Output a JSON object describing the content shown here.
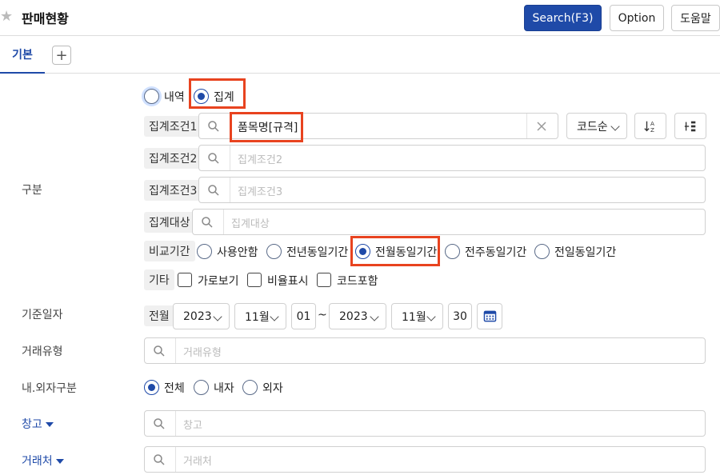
{
  "header": {
    "title": "판매현황",
    "search_label": "Search(F3)",
    "option_label": "Option",
    "help_label": "도움말"
  },
  "tabs": {
    "basic": "기본",
    "add": "+"
  },
  "labels": {
    "gubun": "구분",
    "base_date": "기준일자",
    "trade_type": "거래유형",
    "in_out": "내.외자구분",
    "warehouse": "창고",
    "customer": "거래처"
  },
  "view_mode": {
    "detail": "내역",
    "summary": "집계",
    "selected": "summary"
  },
  "agg": {
    "cond1_tag": "집계조건1",
    "cond1_value": "품목명[규격]",
    "cond2_tag": "집계조건2",
    "cond2_placeholder": "집계조건2",
    "cond3_tag": "집계조건3",
    "cond3_placeholder": "집계조건3",
    "target_tag": "집계대상",
    "target_placeholder": "집계대상",
    "sort_label": "코드순"
  },
  "compare": {
    "tag": "비교기간",
    "options": [
      "사용안함",
      "전년동일기간",
      "전월동일기간",
      "전주동일기간",
      "전일동일기간"
    ],
    "selected": "전월동일기간"
  },
  "etc": {
    "tag": "기타",
    "options": [
      "가로보기",
      "비율표시",
      "코드포함"
    ]
  },
  "date": {
    "tag": "전월",
    "from_year": "2023",
    "from_month": "11월",
    "from_day": "01",
    "sep": "~",
    "to_year": "2023",
    "to_month": "11월",
    "to_day": "30"
  },
  "trade_type_placeholder": "거래유형",
  "in_out": {
    "options": [
      "전체",
      "내자",
      "외자"
    ],
    "selected": "전체"
  },
  "warehouse_placeholder": "창고",
  "customer_placeholder": "거래처",
  "colors": {
    "accent": "#1f4aa8",
    "highlight": "#e8431f"
  }
}
